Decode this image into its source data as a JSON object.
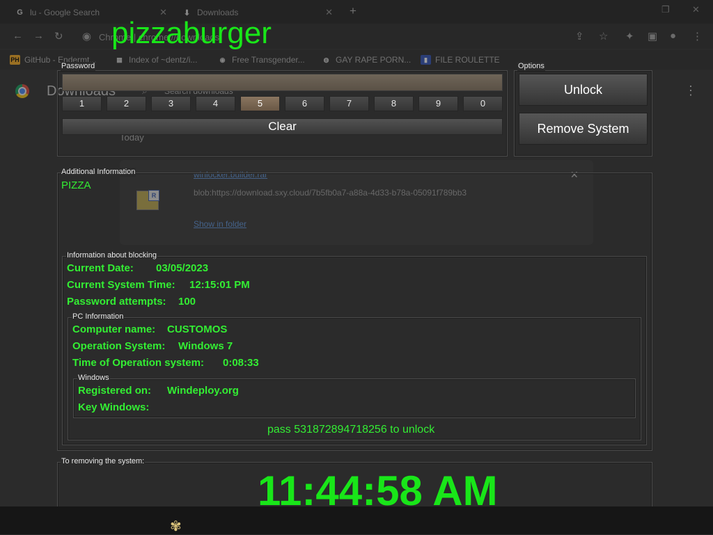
{
  "browser": {
    "tabs": [
      {
        "label": "lu - Google Search",
        "icon": "G"
      },
      {
        "label": "Downloads",
        "icon": "⬇"
      }
    ],
    "omnibox": "Chrome | chrome://downloads",
    "bookmarks": [
      {
        "label": "GitHub - Endermt...",
        "icon": "PH"
      },
      {
        "label": "Index of ~dentz/i...",
        "icon": "▦"
      },
      {
        "label": "Free Transgender...",
        "icon": "◉"
      },
      {
        "label": "GAY RAPE PORN...",
        "icon": "◍"
      },
      {
        "label": "FILE ROULETTE",
        "icon": "▮"
      }
    ],
    "downloads": {
      "title": "Downloads",
      "search_placeholder": "Search downloads",
      "section": "Today",
      "item": {
        "filename": "winlocker.builder.rar",
        "url": "blob:https://download.sxy.cloud/7b5fb0a7-a88a-4d33-b78a-05091f789bb3",
        "action": "Show in folder"
      }
    }
  },
  "locker": {
    "title": "pizzaburger",
    "password": {
      "legend": "Password",
      "keys": [
        "1",
        "2",
        "3",
        "4",
        "5",
        "6",
        "7",
        "8",
        "9",
        "0"
      ],
      "clear": "Clear"
    },
    "options": {
      "legend": "Options",
      "unlock": "Unlock",
      "remove": "Remove System"
    },
    "additional": {
      "legend": "Additional Information",
      "text": "PIZZA"
    },
    "blocking": {
      "legend": "Information about blocking",
      "date_label": "Current Date:",
      "date_value": "03/05/2023",
      "time_label": "Current System Time:",
      "time_value": "12:15:01 PM",
      "attempts_label": "Password attempts:",
      "attempts_value": "100"
    },
    "pc": {
      "legend": "PC Information",
      "computer_label": "Computer name:",
      "computer_value": "CUSTOMOS",
      "os_label": "Operation System:",
      "os_value": "Windows 7",
      "uptime_label": "Time of Operation system:",
      "uptime_value": "0:08:33"
    },
    "windows": {
      "legend": "Windows",
      "registered_label": "Registered on:",
      "registered_value": "Windeploy.org",
      "key_label": "Key Windows:"
    },
    "unlock_hint": "pass 531872894718256 to unlock",
    "removal": {
      "legend": "To removing the system:",
      "clock": "11:44:58 AM"
    }
  },
  "colors": {
    "accent_green": "#19e619",
    "background": "#2b2b2b"
  }
}
